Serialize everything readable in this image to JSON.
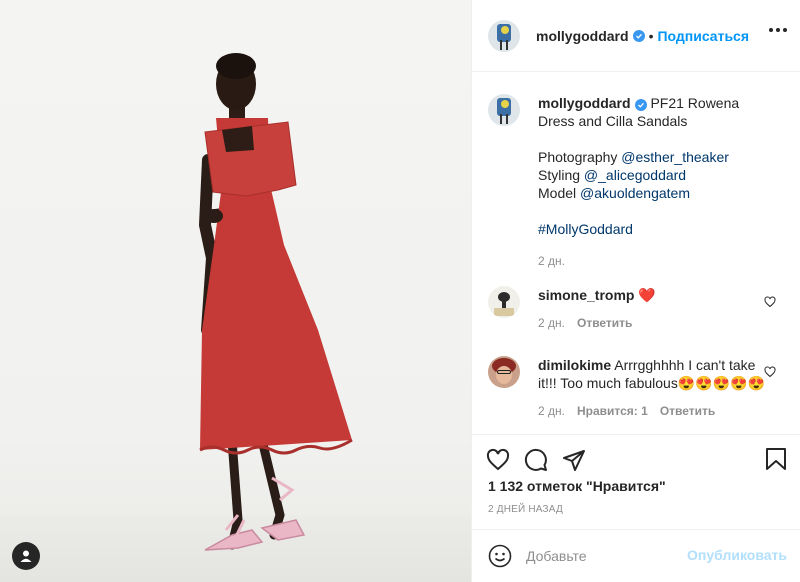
{
  "header": {
    "username": "mollygoddard",
    "follow_label": "Подписаться"
  },
  "caption": {
    "username": "mollygoddard",
    "text": "PF21 Rowena Dress and Cilla Sandals",
    "photography_label": "Photography",
    "photography_handle": "@esther_theaker",
    "styling_label": "Styling",
    "styling_handle": "@_alicegoddard",
    "model_label": "Model",
    "model_handle": "@akuoldengatem",
    "hashtag": "#MollyGoddard",
    "age": "2 дн."
  },
  "comments": [
    {
      "username": "simone_tromp",
      "text": "❤️",
      "age": "2 дн.",
      "reply_label": "Ответить"
    },
    {
      "username": "dimilokime",
      "text": "Arrrgghhhh I can't take it!!! Too much fabulous😍😍😍😍😍",
      "age": "2 дн.",
      "likes_label": "Нравится: 1",
      "reply_label": "Ответить"
    }
  ],
  "likes": "1 132 отметок \"Нравится\"",
  "timestamp": "2 ДНЕЙ НАЗАД",
  "composer": {
    "placeholder": "Добавьте",
    "publish_label": "Опубликовать"
  },
  "icons": [
    "heart-icon",
    "comment-icon",
    "share-icon",
    "bookmark-icon",
    "emoji-icon",
    "user-tag-icon",
    "more-icon",
    "verified-icon"
  ],
  "colors": {
    "accent": "#0095f6",
    "dress": "#c53a36",
    "muted": "#8e8e8e"
  }
}
